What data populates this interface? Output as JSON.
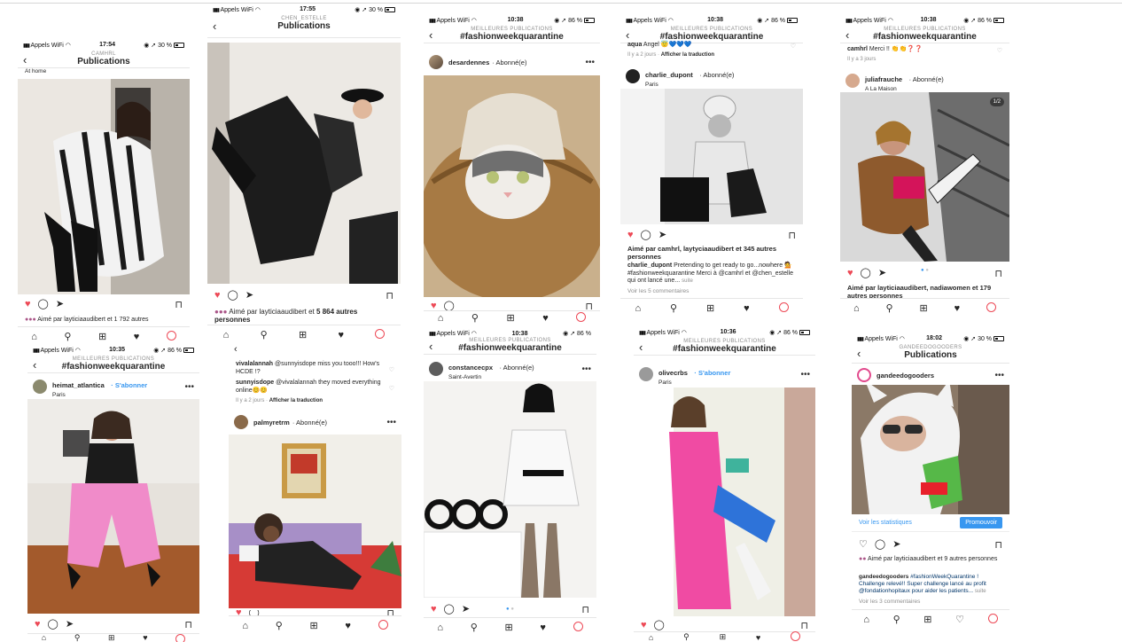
{
  "shots": {
    "s1": {
      "status": {
        "carrier": "Appels WiFi",
        "time": "17:54",
        "battery": "30 %"
      },
      "nav": {
        "kicker": "CAMHRL",
        "title": "Publications"
      },
      "location": "At home",
      "likes": "Aimé par layticiaaudibert et 1 792 autres"
    },
    "s2": {
      "status": {
        "carrier": "Appels WiFi",
        "time": "17:55",
        "battery": "30 %"
      },
      "nav": {
        "kicker": "CHEN_ESTELLE",
        "title": "Publications"
      },
      "likes_prefix": "Aimé par layticiaaudibert et",
      "likes_count": "5 864 autres",
      "likes_suffix": "personnes"
    },
    "s3": {
      "status": {
        "carrier": "Appels WiFi",
        "time": "10:38",
        "battery": "86 %"
      },
      "nav": {
        "kicker": "MEILLEURES PUBLICATIONS",
        "title": "#fashionweekquarantine"
      },
      "user": "desardennes",
      "follow": "Abonné(e)"
    },
    "s4": {
      "status": {
        "carrier": "Appels WiFi",
        "time": "10:38",
        "battery": "86 %"
      },
      "nav": {
        "kicker": "MEILLEURES PUBLICATIONS",
        "title": "#fashionweekquarantine"
      },
      "top_comment_user": "aqua",
      "top_comment": "Angel 😇💙💙💙",
      "top_meta": "Il y a 2 jours",
      "top_translate": "Afficher la traduction",
      "user": "charlie_dupont",
      "follow": "Abonné(e)",
      "location": "Paris",
      "likes": "Aimé par camhrl, laytyciaaudibert et 345 autres personnes",
      "caption_user": "charlie_dupont",
      "caption": "Pretending to get ready to go...nowhere 💁 #fashionweekquarantine Merci à @camhrl et @chen_estelle qui ont lancé une...",
      "more": "suite",
      "view_comments": "Voir les 5 commentaires"
    },
    "s5": {
      "status": {
        "carrier": "Appels WiFi",
        "time": "10:38",
        "battery": "86 %"
      },
      "nav": {
        "kicker": "MEILLEURES PUBLICATIONS",
        "title": "#fashionweekquarantine"
      },
      "top_comment_user": "camhrl",
      "top_comment": "Merci !! 👏👏❓❓",
      "top_meta": "Il y a 3 jours",
      "user": "juliafrauche",
      "follow": "Abonné(e)",
      "location": "A La Maison",
      "pager": "1/2",
      "likes": "Aimé par layticiaaudibert, nadiawomen et 179 autres personnes"
    },
    "s6": {
      "status": {
        "carrier": "Appels WiFi",
        "time": "10:35",
        "battery": "86 %"
      },
      "nav": {
        "kicker": "MEILLEURES PUBLICATIONS",
        "title": "#fashionweekquarantine"
      },
      "user": "heimat_atlantica",
      "follow": "S'abonner",
      "location": "Paris"
    },
    "s7": {
      "c1_user": "vivalalannah",
      "c1": "@sunnyisdope miss you tooo!!! How's HCDE !?",
      "c2_user": "sunnyisdope",
      "c2": "@vivalalannah they moved everything online😊😊",
      "meta": "Il y a 2 jours",
      "translate": "Afficher la traduction",
      "user": "palmyretrm",
      "follow": "Abonné(e)"
    },
    "s8": {
      "status": {
        "carrier": "Appels WiFi",
        "time": "10:38",
        "battery": "86 %"
      },
      "nav": {
        "kicker": "MEILLEURES PUBLICATIONS",
        "title": "#fashionweekquarantine"
      },
      "user": "constancecpx",
      "follow": "Abonné(e)",
      "location": "Saint-Avertin"
    },
    "s9": {
      "status": {
        "carrier": "Appels WiFi",
        "time": "10:36",
        "battery": "86 %"
      },
      "nav": {
        "kicker": "MEILLEURES PUBLICATIONS",
        "title": "#fashionweekquarantine"
      },
      "user": "olivecrbs",
      "follow": "S'abonner",
      "location": "Paris"
    },
    "s10": {
      "status": {
        "carrier": "Appels WiFi",
        "time": "18:02",
        "battery": "30 %"
      },
      "nav": {
        "kicker": "GANDEEDOGOODERS",
        "title": "Publications"
      },
      "user": "gandeedogooders",
      "stats": "Voir les statistiques",
      "promote": "Promouvoir",
      "likes": "Aimé par layticiaaudibert et 9 autres personnes",
      "caption_user": "gandeedogooders",
      "caption": "#fashionWeekQuarantine ! Challenge relevé!! Super challenge lancé au profit @fondationhopitaux pour aider les patients...",
      "more": "suite",
      "view_comments": "Voir les 3 commentaires"
    }
  },
  "colors": {
    "like_red": "#ed4956",
    "link_blue": "#3897f0",
    "hashtag": "#003569"
  },
  "icons": {
    "back": "chevron-left-icon",
    "more": "more-dots-icon",
    "like": "heart-icon",
    "comment": "comment-icon",
    "share": "share-icon",
    "save": "bookmark-icon",
    "home": "home-icon",
    "search": "search-icon",
    "add": "add-icon",
    "activity": "heart-icon"
  }
}
